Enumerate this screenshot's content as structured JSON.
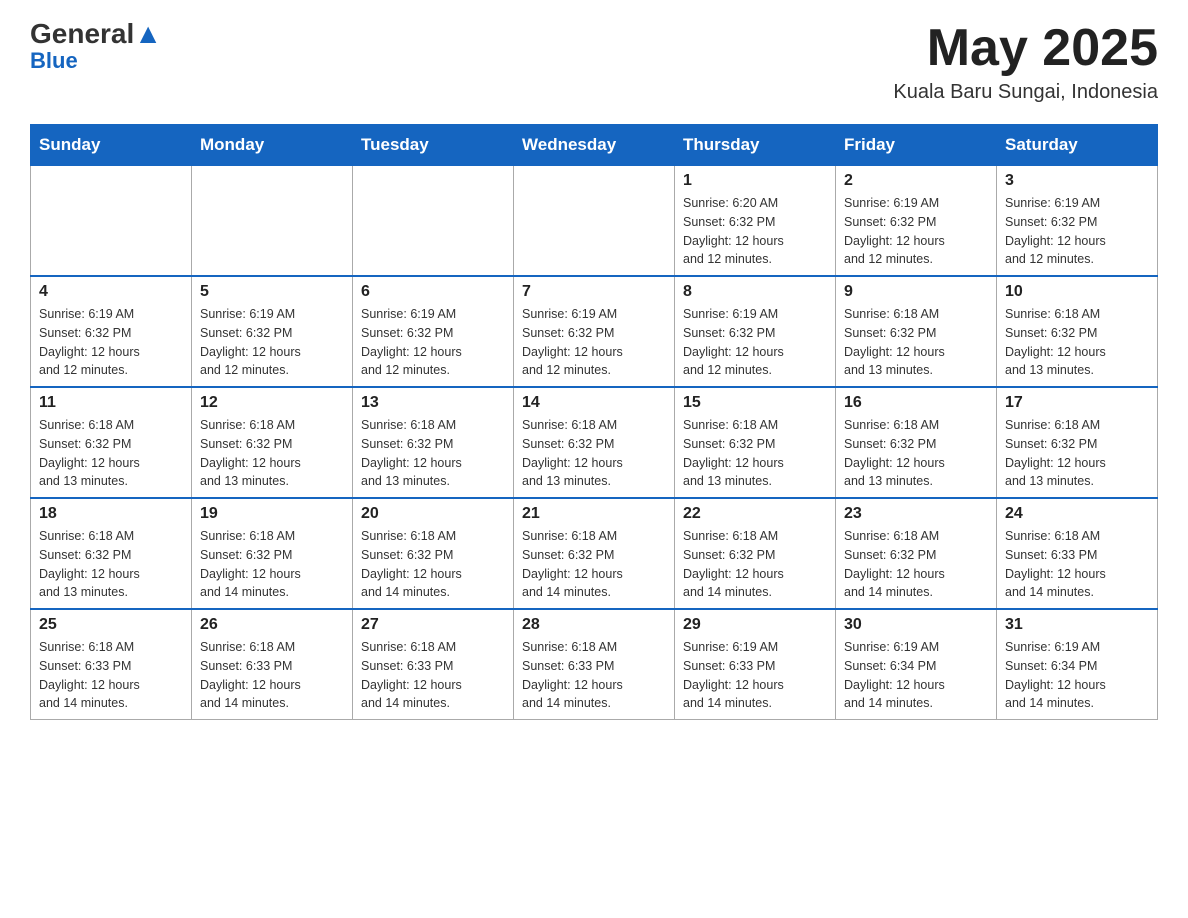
{
  "logo": {
    "general": "General",
    "blue": "Blue",
    "triangle_label": "triangle-decoration"
  },
  "header": {
    "month_year": "May 2025",
    "location": "Kuala Baru Sungai, Indonesia"
  },
  "days_of_week": [
    "Sunday",
    "Monday",
    "Tuesday",
    "Wednesday",
    "Thursday",
    "Friday",
    "Saturday"
  ],
  "weeks": [
    {
      "days": [
        {
          "number": "",
          "info": ""
        },
        {
          "number": "",
          "info": ""
        },
        {
          "number": "",
          "info": ""
        },
        {
          "number": "",
          "info": ""
        },
        {
          "number": "1",
          "info": "Sunrise: 6:20 AM\nSunset: 6:32 PM\nDaylight: 12 hours\nand 12 minutes."
        },
        {
          "number": "2",
          "info": "Sunrise: 6:19 AM\nSunset: 6:32 PM\nDaylight: 12 hours\nand 12 minutes."
        },
        {
          "number": "3",
          "info": "Sunrise: 6:19 AM\nSunset: 6:32 PM\nDaylight: 12 hours\nand 12 minutes."
        }
      ]
    },
    {
      "days": [
        {
          "number": "4",
          "info": "Sunrise: 6:19 AM\nSunset: 6:32 PM\nDaylight: 12 hours\nand 12 minutes."
        },
        {
          "number": "5",
          "info": "Sunrise: 6:19 AM\nSunset: 6:32 PM\nDaylight: 12 hours\nand 12 minutes."
        },
        {
          "number": "6",
          "info": "Sunrise: 6:19 AM\nSunset: 6:32 PM\nDaylight: 12 hours\nand 12 minutes."
        },
        {
          "number": "7",
          "info": "Sunrise: 6:19 AM\nSunset: 6:32 PM\nDaylight: 12 hours\nand 12 minutes."
        },
        {
          "number": "8",
          "info": "Sunrise: 6:19 AM\nSunset: 6:32 PM\nDaylight: 12 hours\nand 12 minutes."
        },
        {
          "number": "9",
          "info": "Sunrise: 6:18 AM\nSunset: 6:32 PM\nDaylight: 12 hours\nand 13 minutes."
        },
        {
          "number": "10",
          "info": "Sunrise: 6:18 AM\nSunset: 6:32 PM\nDaylight: 12 hours\nand 13 minutes."
        }
      ]
    },
    {
      "days": [
        {
          "number": "11",
          "info": "Sunrise: 6:18 AM\nSunset: 6:32 PM\nDaylight: 12 hours\nand 13 minutes."
        },
        {
          "number": "12",
          "info": "Sunrise: 6:18 AM\nSunset: 6:32 PM\nDaylight: 12 hours\nand 13 minutes."
        },
        {
          "number": "13",
          "info": "Sunrise: 6:18 AM\nSunset: 6:32 PM\nDaylight: 12 hours\nand 13 minutes."
        },
        {
          "number": "14",
          "info": "Sunrise: 6:18 AM\nSunset: 6:32 PM\nDaylight: 12 hours\nand 13 minutes."
        },
        {
          "number": "15",
          "info": "Sunrise: 6:18 AM\nSunset: 6:32 PM\nDaylight: 12 hours\nand 13 minutes."
        },
        {
          "number": "16",
          "info": "Sunrise: 6:18 AM\nSunset: 6:32 PM\nDaylight: 12 hours\nand 13 minutes."
        },
        {
          "number": "17",
          "info": "Sunrise: 6:18 AM\nSunset: 6:32 PM\nDaylight: 12 hours\nand 13 minutes."
        }
      ]
    },
    {
      "days": [
        {
          "number": "18",
          "info": "Sunrise: 6:18 AM\nSunset: 6:32 PM\nDaylight: 12 hours\nand 13 minutes."
        },
        {
          "number": "19",
          "info": "Sunrise: 6:18 AM\nSunset: 6:32 PM\nDaylight: 12 hours\nand 14 minutes."
        },
        {
          "number": "20",
          "info": "Sunrise: 6:18 AM\nSunset: 6:32 PM\nDaylight: 12 hours\nand 14 minutes."
        },
        {
          "number": "21",
          "info": "Sunrise: 6:18 AM\nSunset: 6:32 PM\nDaylight: 12 hours\nand 14 minutes."
        },
        {
          "number": "22",
          "info": "Sunrise: 6:18 AM\nSunset: 6:32 PM\nDaylight: 12 hours\nand 14 minutes."
        },
        {
          "number": "23",
          "info": "Sunrise: 6:18 AM\nSunset: 6:32 PM\nDaylight: 12 hours\nand 14 minutes."
        },
        {
          "number": "24",
          "info": "Sunrise: 6:18 AM\nSunset: 6:33 PM\nDaylight: 12 hours\nand 14 minutes."
        }
      ]
    },
    {
      "days": [
        {
          "number": "25",
          "info": "Sunrise: 6:18 AM\nSunset: 6:33 PM\nDaylight: 12 hours\nand 14 minutes."
        },
        {
          "number": "26",
          "info": "Sunrise: 6:18 AM\nSunset: 6:33 PM\nDaylight: 12 hours\nand 14 minutes."
        },
        {
          "number": "27",
          "info": "Sunrise: 6:18 AM\nSunset: 6:33 PM\nDaylight: 12 hours\nand 14 minutes."
        },
        {
          "number": "28",
          "info": "Sunrise: 6:18 AM\nSunset: 6:33 PM\nDaylight: 12 hours\nand 14 minutes."
        },
        {
          "number": "29",
          "info": "Sunrise: 6:19 AM\nSunset: 6:33 PM\nDaylight: 12 hours\nand 14 minutes."
        },
        {
          "number": "30",
          "info": "Sunrise: 6:19 AM\nSunset: 6:34 PM\nDaylight: 12 hours\nand 14 minutes."
        },
        {
          "number": "31",
          "info": "Sunrise: 6:19 AM\nSunset: 6:34 PM\nDaylight: 12 hours\nand 14 minutes."
        }
      ]
    }
  ]
}
